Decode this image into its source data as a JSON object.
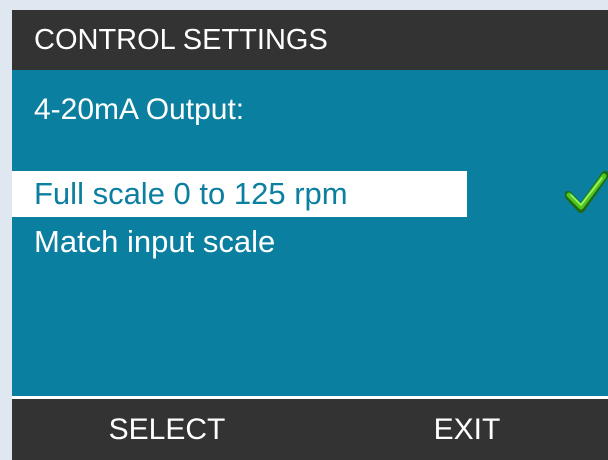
{
  "header": {
    "title": "CONTROL SETTINGS"
  },
  "content": {
    "label": "4-20mA Output:",
    "options": [
      {
        "label": "Full scale 0 to 125 rpm",
        "selected": true,
        "checked": true
      },
      {
        "label": "Match input scale",
        "selected": false,
        "checked": false
      }
    ]
  },
  "footer": {
    "left_softkey": "SELECT",
    "right_softkey": "EXIT"
  },
  "icons": {
    "selected_indicator": "check-icon"
  },
  "colors": {
    "screen_background": "#0b7f9f",
    "header_footer_background": "#333333",
    "selected_background": "#ffffff",
    "selected_text": "#0b7f9f",
    "check_green": "#4cc81e"
  }
}
